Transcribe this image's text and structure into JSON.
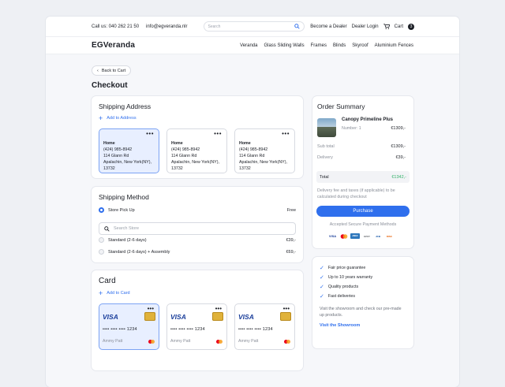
{
  "topbar": {
    "phone": "Call us: 040 262 21 50",
    "email": "info@egveranda.nlr",
    "search_placeholder": "Search",
    "become_dealer": "Become a Dealer",
    "dealer_login": "Dealer Login",
    "cart_label": "Cart",
    "cart_count": "3"
  },
  "brand": {
    "logo": "EGVeranda"
  },
  "nav": [
    "Veranda",
    "Glass Sliding Walls",
    "Frames",
    "Blinds",
    "Skyroof",
    "Aluminium Fences"
  ],
  "back_label": "Back to Cart",
  "page_title": "Checkout",
  "shipping_address": {
    "title": "Shipping Address",
    "add_label": "Add to Address",
    "cards": [
      {
        "name": "Home",
        "phone": "(424) 985-8942",
        "street": "114 Glann Rd",
        "city": "Apalachin, New York(NY),",
        "zip": "13732",
        "selected": true
      },
      {
        "name": "Home",
        "phone": "(424) 985-8942",
        "street": "114 Glann Rd",
        "city": "Apalachin, New York(NY),",
        "zip": "13732",
        "selected": false
      },
      {
        "name": "Home",
        "phone": "(424) 985-8942",
        "street": "114 Glann Rd",
        "city": "Apalachin, New York(NY),",
        "zip": "13732",
        "selected": false
      }
    ]
  },
  "shipping_method": {
    "title": "Shipping Method",
    "pickup": {
      "label": "Store Pick Up",
      "price": "Free"
    },
    "search_placeholder": "Search Store",
    "options": [
      {
        "label": "Standard (2-6 days)",
        "price": "€39,-"
      },
      {
        "label": "Standard (2-6 days) + Assembly",
        "price": "€69,-"
      }
    ]
  },
  "card_section": {
    "title": "Card",
    "add_label": "Add to Card",
    "cards": [
      {
        "brand": "VISA",
        "number": "•••• •••• •••• 1234",
        "holder": "Ammy Patt",
        "selected": true
      },
      {
        "brand": "VISA",
        "number": "•••• •••• •••• 1234",
        "holder": "Ammy Patt",
        "selected": false
      },
      {
        "brand": "VISA",
        "number": "•••• •••• •••• 1234",
        "holder": "Ammy Patt",
        "selected": false
      }
    ]
  },
  "order_summary": {
    "title": "Order Summary",
    "product_name": "Canopy Primeline Plus",
    "product_number": "Number: 1",
    "product_price": "€1309,-",
    "subtotal_label": "Sub total",
    "subtotal": "€1309,-",
    "delivery_label": "Delivery",
    "delivery": "€39,-",
    "total_label": "Total",
    "total": "€1342,-",
    "note": "Delivery fee and taxes (if applicable) to be calculated during checkout",
    "purchase_label": "Purchase",
    "payment_methods_label": "Accepted Secure Payment Methods",
    "payment_methods": [
      "VISA",
      "MC",
      "AMEX",
      "GPAY",
      "JCB",
      "DISC"
    ]
  },
  "guarantees": {
    "items": [
      "Fair price guarantee",
      "Up to 10 years warranty",
      "Quality products",
      "Fast deliveries"
    ],
    "note": "Visit the showroom and check our pre-made up products.",
    "link": "Visit the Showroom"
  },
  "colors": {
    "accent": "#2f6fed",
    "selected_bg": "#e8efff",
    "total_green": "#34b36a"
  }
}
